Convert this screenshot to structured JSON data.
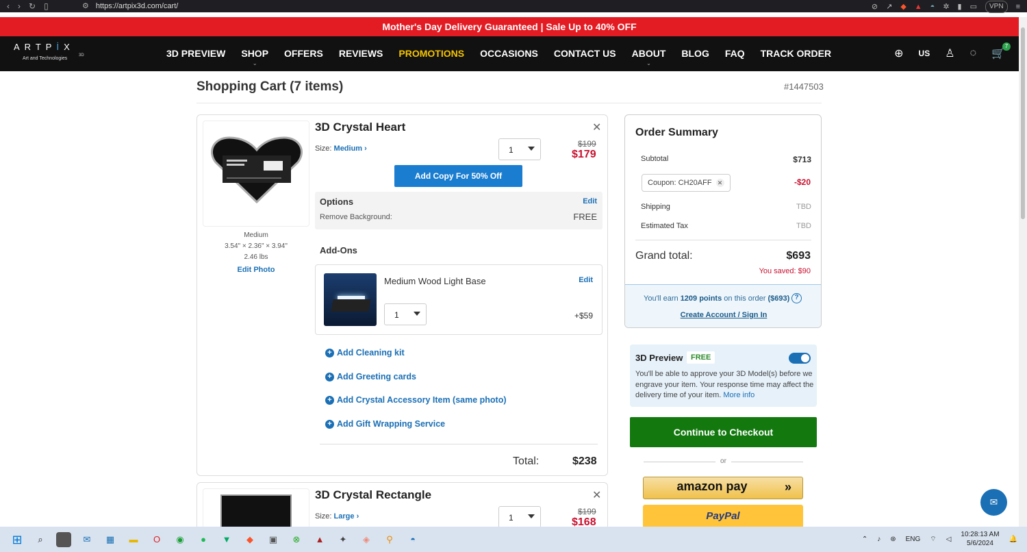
{
  "browser": {
    "url": "https://artpix3d.com/cart/",
    "vpn": "VPN"
  },
  "promo_bar": "Mother's Day Delivery Guaranteed | Sale Up to 40% OFF",
  "header": {
    "logo_word_1": "ART",
    "logo_word_2": "P",
    "logo_word_3": "İ",
    "logo_word_4": "X",
    "logo_3d": "3D",
    "logo_sub": "Art and Technologies",
    "nav": [
      "3D PREVIEW",
      "SHOP",
      "OFFERS",
      "REVIEWS",
      "PROMOTIONS",
      "OCCASIONS",
      "CONTACT US",
      "ABOUT",
      "BLOG",
      "FAQ",
      "TRACK ORDER"
    ],
    "region": "US",
    "cart_count": "7"
  },
  "page": {
    "title": "Shopping Cart (7 items)",
    "order_number": "#1447503"
  },
  "items": [
    {
      "name": "3D Crystal Heart",
      "size_label": "Size:",
      "size_value": "Medium",
      "thumb_size": "Medium",
      "dimensions": "3.54\" × 2.36\" × 3.94\"",
      "weight": "2.46 lbs",
      "edit_photo": "Edit Photo",
      "quantity": "1",
      "old_price": "$199",
      "new_price": "$179",
      "add_copy": "Add Copy For 50% Off",
      "options_label": "Options",
      "options_edit": "Edit",
      "option_name": "Remove Background:",
      "option_value": "FREE",
      "addons_label": "Add-Ons",
      "addon": {
        "name": "Medium Wood Light Base",
        "edit": "Edit",
        "quantity": "1",
        "price": "+$59"
      },
      "add_links": [
        "Add Cleaning kit",
        "Add Greeting cards",
        "Add Crystal Accessory Item (same photo)",
        "Add Gift Wrapping Service"
      ],
      "total_label": "Total:",
      "total_value": "$238"
    },
    {
      "name": "3D Crystal Rectangle",
      "size_label": "Size:",
      "size_value": "Large",
      "quantity": "1",
      "old_price": "$199",
      "new_price": "$168"
    }
  ],
  "summary": {
    "title": "Order Summary",
    "subtotal_label": "Subtotal",
    "subtotal": "$713",
    "coupon": "Coupon: CH20AFF",
    "coupon_amount": "-$20",
    "shipping_label": "Shipping",
    "shipping": "TBD",
    "tax_label": "Estimated Tax",
    "tax": "TBD",
    "grand_label": "Grand total:",
    "grand_total": "$693",
    "saved": "You saved: $90",
    "points_pre": "You'll earn",
    "points": "1209 points",
    "points_post": "on this order",
    "points_amount": "($693)",
    "sign_in": "Create Account / Sign In"
  },
  "preview": {
    "title": "3D Preview",
    "badge": "FREE",
    "description": "You'll be able to approve your 3D Model(s) before we engrave your item. Your response time may affect the delivery time of your item.",
    "more": "More info"
  },
  "checkout": {
    "button": "Continue to Checkout",
    "or": "or",
    "amazon": "amazon pay",
    "amazon_arrow": "»",
    "paypal": "PayPal"
  },
  "taskbar": {
    "lang": "ENG",
    "time": "10:28:13 AM",
    "date": "5/6/2024"
  },
  "colors": {
    "promo_red": "#e31b23",
    "link_blue": "#1a6fb5",
    "price_red": "#c8102e",
    "checkout_green": "#13790f"
  }
}
